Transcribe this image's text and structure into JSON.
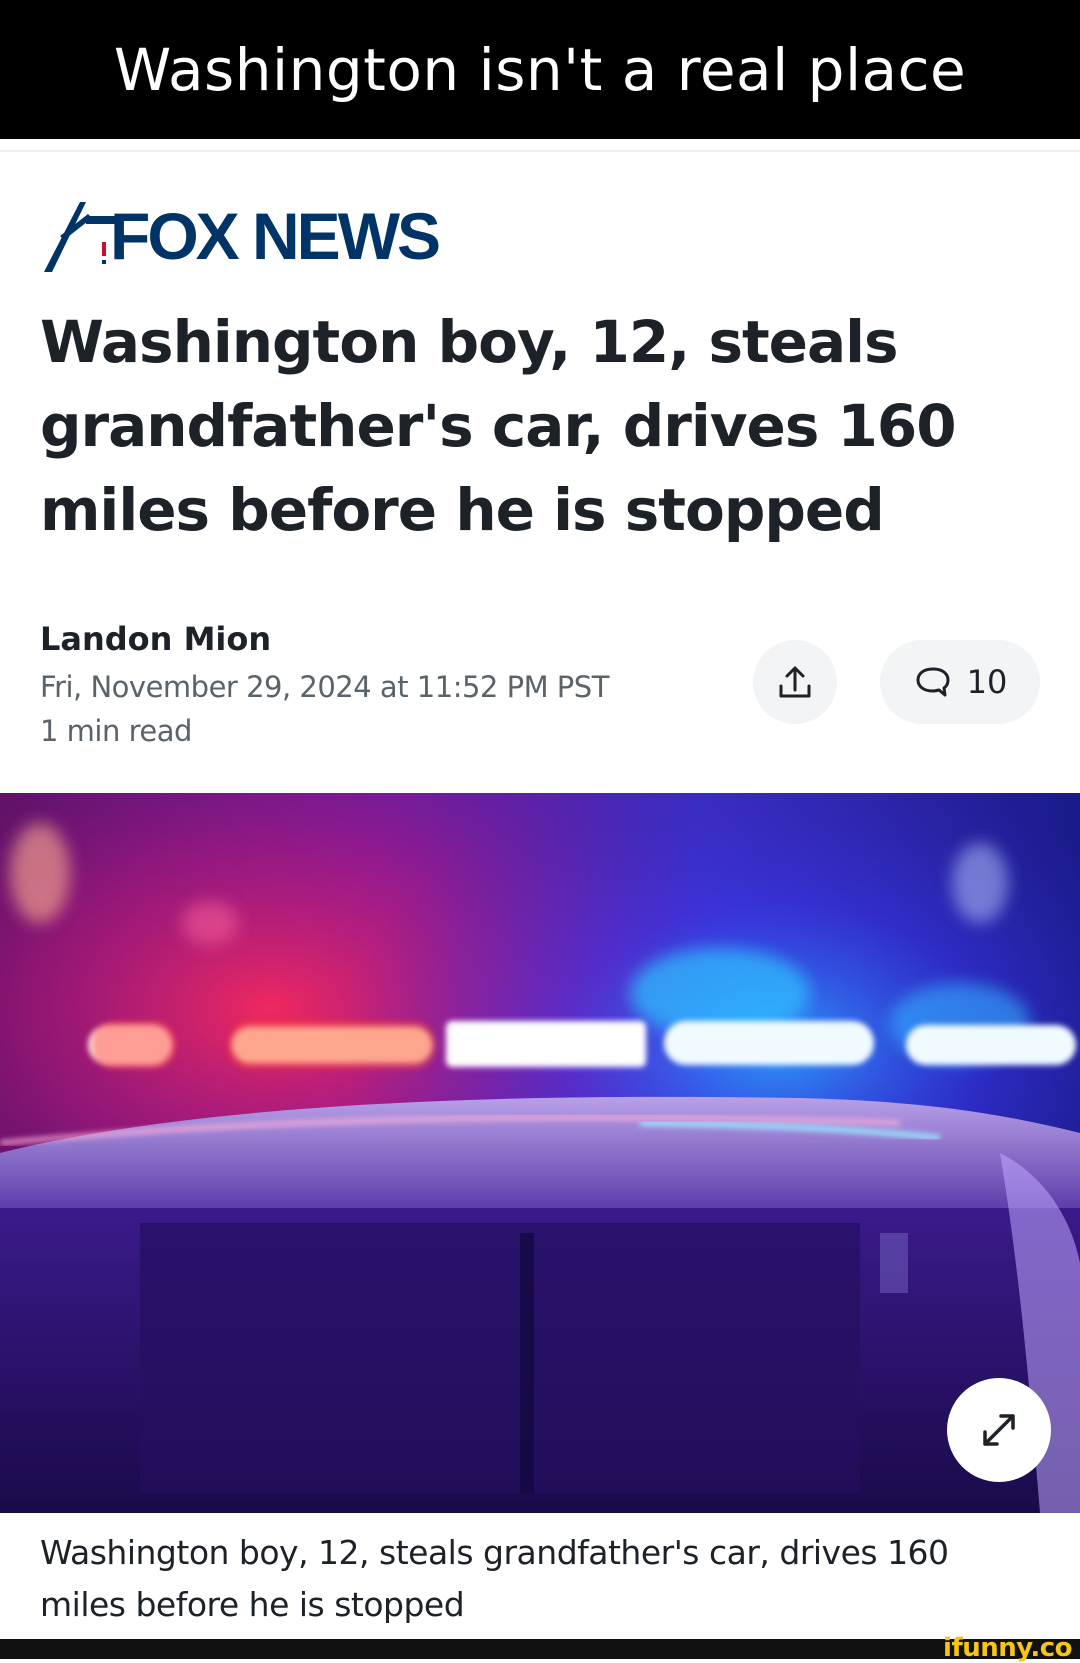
{
  "meme": {
    "caption": "Washington isn't a real place"
  },
  "article": {
    "source_logo_text": "FOX NEWS",
    "headline": "Washington boy, 12, steals grandfather's car, drives 160 miles before he is stopped",
    "author": "Landon Mion",
    "date": "Fri, November 29, 2024 at 11:52 PM PST",
    "read_time": "1 min read",
    "comment_count": "10",
    "image_caption": "Washington boy, 12, steals grandfather's car, drives 160 miles before he is stopped"
  },
  "icons": {
    "share": "share-icon",
    "comment": "comment-icon",
    "expand": "expand-icon",
    "logo": "fox-news-logo"
  },
  "colors": {
    "brand": "#003366",
    "text": "#1d2228",
    "muted": "#5b636a",
    "button_bg": "#f2f4f5",
    "watermark": "#f5c518"
  },
  "watermark": "ifunny.co"
}
